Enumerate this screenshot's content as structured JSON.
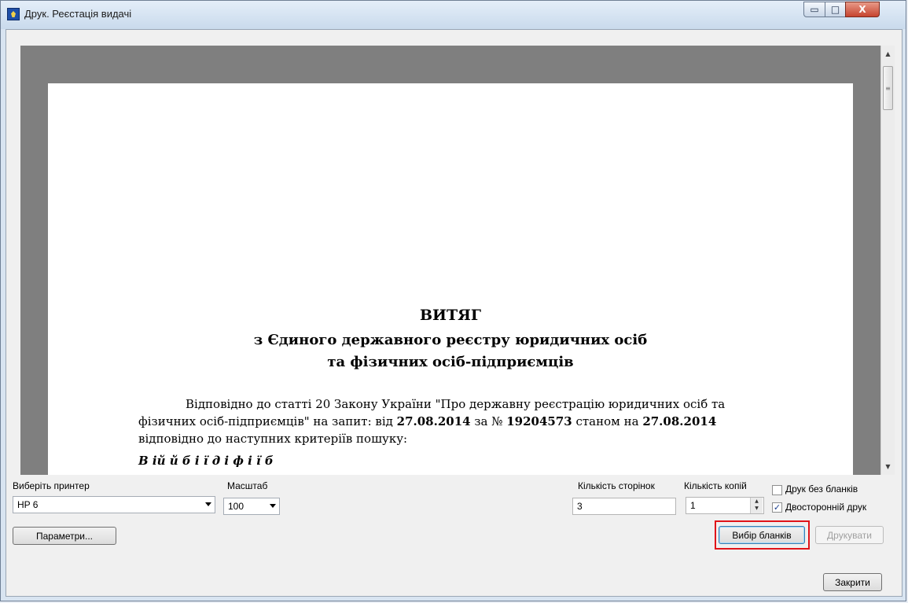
{
  "window": {
    "title": "Друк. Реєстація видачі"
  },
  "title_buttons": {
    "minimize": "▭",
    "maximize": "□",
    "close": "X"
  },
  "document": {
    "title1": "ВИТЯГ",
    "title2": "з Єдиного державного реєстру юридичних осіб",
    "title3": "та фізичних осіб-підприємців",
    "para_line1": "Відповідно до статті 20 Закону України \"Про державну реєстрацію юридичних осіб та",
    "para_line2_a": "фізичних осіб-підприємців\" на запит:  від ",
    "para_line2_date1": "27.08.2014",
    "para_line2_b": " за № ",
    "para_line2_num": "19204573",
    "para_line2_c": " станом на ",
    "para_line2_date2": "27.08.2014",
    "para_line3": "відповідно до наступних критеріїв пошуку:",
    "para_line4_partial": "В            ій    й         б  і      ї                                                     д    і                  ф      і    ї     б"
  },
  "scrollbar": {
    "up": "▲",
    "down": "▼",
    "grip": "≡"
  },
  "controls": {
    "printer_label": "Виберіть принтер",
    "printer_value": "HP 6",
    "scale_label": "Масштаб",
    "scale_value": "100",
    "pages_label": "Кількість сторінок",
    "pages_value": "3",
    "copies_label": "Кількість копій",
    "copies_value": "1",
    "no_blanks_label": "Друк без бланків",
    "no_blanks_checked": false,
    "duplex_label": "Двосторонній друк",
    "duplex_checked": true,
    "params_button": "Параметри...",
    "choose_blanks_button": "Вибір бланків",
    "print_button": "Друкувати",
    "close_button": "Закрити"
  }
}
